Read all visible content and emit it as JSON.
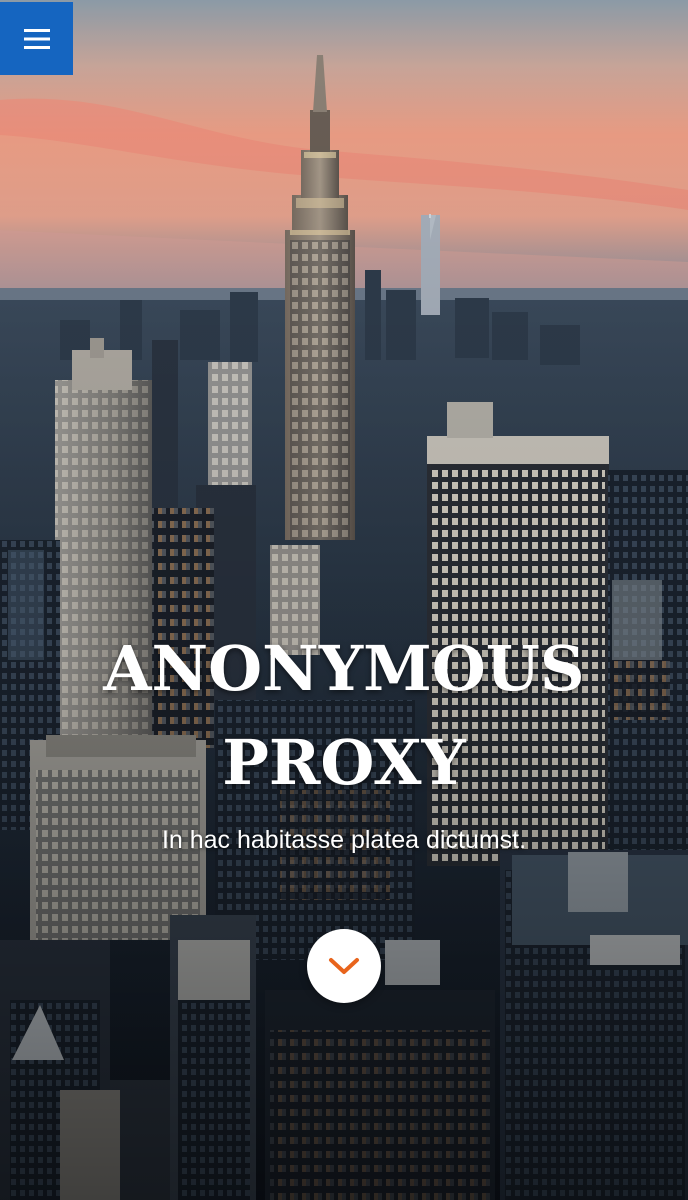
{
  "hero": {
    "title_line1": "ANONYMOUS",
    "title_line2": "PROXY",
    "subtitle": "In hac habitasse platea dictumst."
  },
  "menu_button": {
    "icon": "hamburger-menu-icon",
    "color": "#1565c0"
  },
  "scroll_button": {
    "icon": "chevron-down-icon",
    "icon_color": "#e8641c"
  },
  "background": {
    "image": "city-skyline-photo"
  }
}
